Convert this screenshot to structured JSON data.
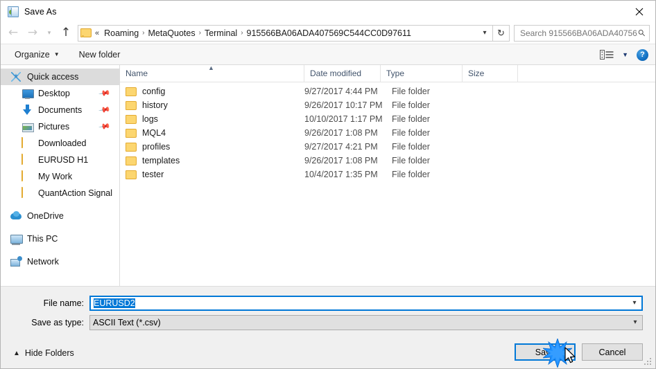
{
  "window": {
    "title": "Save As",
    "title_icon": "save-as-app-icon",
    "close_icon": "close-icon"
  },
  "nav": {
    "back_icon": "back-arrow-icon",
    "forward_icon": "forward-arrow-icon",
    "recent_icon": "chevron-down-icon",
    "up_icon": "up-arrow-icon",
    "refresh_icon": "refresh-icon",
    "address_dropdown_icon": "chevron-down-icon",
    "folder_icon": "folder-icon",
    "breadcrumb_prefix": "«",
    "breadcrumbs": [
      "Roaming",
      "MetaQuotes",
      "Terminal",
      "915566BA06ADA407569C544CC0D97611"
    ],
    "separator": "›"
  },
  "search": {
    "placeholder": "Search 915566BA06ADA40756...",
    "icon": "search-icon"
  },
  "toolbar": {
    "organize_label": "Organize",
    "organize_caret": "▼",
    "new_folder_label": "New folder",
    "view_icon": "view-layout-icon",
    "view_caret": "▼",
    "help_icon": "help-icon",
    "help_label": "?"
  },
  "sidebar": {
    "items": [
      {
        "label": "Quick access",
        "icon": "quick-access-star-icon",
        "type": "star",
        "selected": true,
        "indent": false,
        "pinned": false,
        "group": false
      },
      {
        "label": "Desktop",
        "icon": "desktop-icon",
        "type": "desktop",
        "selected": false,
        "indent": true,
        "pinned": true,
        "group": false
      },
      {
        "label": "Documents",
        "icon": "documents-icon",
        "type": "docs",
        "selected": false,
        "indent": true,
        "pinned": true,
        "group": false
      },
      {
        "label": "Pictures",
        "icon": "pictures-icon",
        "type": "pics",
        "selected": false,
        "indent": true,
        "pinned": true,
        "group": false
      },
      {
        "label": "Downloaded",
        "icon": "folder-icon",
        "type": "folder",
        "selected": false,
        "indent": true,
        "pinned": false,
        "group": false
      },
      {
        "label": "EURUSD H1",
        "icon": "folder-icon",
        "type": "folder",
        "selected": false,
        "indent": true,
        "pinned": false,
        "group": false
      },
      {
        "label": "My Work",
        "icon": "folder-icon",
        "type": "folder",
        "selected": false,
        "indent": true,
        "pinned": false,
        "group": false
      },
      {
        "label": "QuantAction Signal",
        "icon": "folder-icon",
        "type": "folder",
        "selected": false,
        "indent": true,
        "pinned": false,
        "group": false
      },
      {
        "label": "OneDrive",
        "icon": "onedrive-icon",
        "type": "onedrive",
        "selected": false,
        "indent": false,
        "pinned": false,
        "group": true
      },
      {
        "label": "This PC",
        "icon": "this-pc-icon",
        "type": "thispc",
        "selected": false,
        "indent": false,
        "pinned": false,
        "group": true
      },
      {
        "label": "Network",
        "icon": "network-icon",
        "type": "network",
        "selected": false,
        "indent": false,
        "pinned": false,
        "group": true
      }
    ]
  },
  "filelist": {
    "columns": [
      "Name",
      "Date modified",
      "Type",
      "Size"
    ],
    "sort_column": "Name",
    "sort_direction": "ascending",
    "sort_icon": "sort-ascending-caret-icon",
    "rows": [
      {
        "name": "config",
        "date": "9/27/2017 4:44 PM",
        "type": "File folder",
        "size": "",
        "icon": "folder-icon"
      },
      {
        "name": "history",
        "date": "9/26/2017 10:17 PM",
        "type": "File folder",
        "size": "",
        "icon": "folder-icon"
      },
      {
        "name": "logs",
        "date": "10/10/2017 1:17 PM",
        "type": "File folder",
        "size": "",
        "icon": "folder-icon"
      },
      {
        "name": "MQL4",
        "date": "9/26/2017 1:08 PM",
        "type": "File folder",
        "size": "",
        "icon": "folder-icon"
      },
      {
        "name": "profiles",
        "date": "9/27/2017 4:21 PM",
        "type": "File folder",
        "size": "",
        "icon": "folder-icon"
      },
      {
        "name": "templates",
        "date": "9/26/2017 1:08 PM",
        "type": "File folder",
        "size": "",
        "icon": "folder-icon"
      },
      {
        "name": "tester",
        "date": "10/4/2017 1:35 PM",
        "type": "File folder",
        "size": "",
        "icon": "folder-icon"
      }
    ]
  },
  "form": {
    "file_name_label": "File name:",
    "file_name_value": "EURUSD2",
    "file_name_selected": true,
    "save_as_type_label": "Save as type:",
    "save_as_type_value": "ASCII Text (*.csv)",
    "dropdown_icon": "chevron-down-icon"
  },
  "actions": {
    "hide_folders_label": "Hide Folders",
    "hide_folders_icon": "chevron-up-icon",
    "save_label": "Save",
    "cancel_label": "Cancel",
    "default_button": "Save",
    "resize_grip_icon": "resize-grip-icon",
    "cursor_icon": "mouse-pointer-icon",
    "click_effect_icon": "click-burst-icon"
  },
  "colors": {
    "accent": "#0078d7",
    "selection": "#0078d7",
    "sidebar_selected": "#dcdcdc",
    "folder_yellow": "#fcd670",
    "header_text": "#41536b",
    "burst": "#1e90ff"
  }
}
